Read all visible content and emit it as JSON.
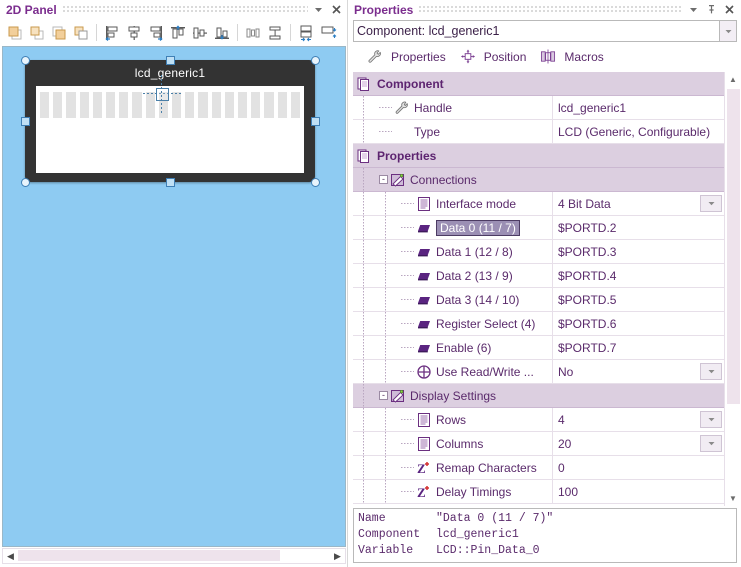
{
  "left": {
    "title": "2D Panel",
    "titlebar_icons": [
      "grip-dots",
      "chevron-down-icon",
      "close-icon"
    ],
    "toolbar": [
      {
        "name": "bring-to-front-button",
        "tip": "Bring to Front"
      },
      {
        "name": "bring-forward-button",
        "tip": "Bring Forward"
      },
      {
        "name": "send-backward-button",
        "tip": "Send Backward"
      },
      {
        "name": "send-to-back-button",
        "tip": "Send to Back"
      },
      {
        "name": "align-left-button",
        "tip": "Align Left"
      },
      {
        "name": "align-center-horizontal-button",
        "tip": "Align Center"
      },
      {
        "name": "align-right-button",
        "tip": "Align Right"
      },
      {
        "name": "align-top-button",
        "tip": "Align Top"
      },
      {
        "name": "align-middle-button",
        "tip": "Align Middle"
      },
      {
        "name": "align-bottom-button",
        "tip": "Align Bottom"
      },
      {
        "name": "distribute-horizontal-button",
        "tip": "Distribute Horizontally"
      },
      {
        "name": "distribute-vertical-button",
        "tip": "Distribute Vertically"
      },
      {
        "name": "make-same-width-button",
        "tip": "Same Width"
      },
      {
        "name": "make-same-height-button",
        "tip": "Same Height"
      }
    ],
    "canvas": {
      "background_color": "#8ecbf2",
      "component_label": "lcd_generic1",
      "component_body_color": "#333333",
      "screen_color": "#ffffff",
      "cell_color": "#e2e2e2",
      "cell_count": 20
    },
    "hscroll": {
      "left_arrow": "◀",
      "right_arrow": "▶"
    }
  },
  "right": {
    "title": "Properties",
    "titlebar_icons": [
      "grip-dots",
      "chevron-down-icon",
      "pin-icon",
      "close-icon"
    ],
    "component_selector": {
      "value": "Component: lcd_generic1",
      "caret": "▾"
    },
    "tabs": [
      {
        "label": "Properties",
        "icon": "wrench-icon",
        "active": true
      },
      {
        "label": "Position",
        "icon": "move-arrows-icon",
        "active": false
      },
      {
        "label": "Macros",
        "icon": "macros-icon",
        "active": false
      }
    ],
    "rows": [
      {
        "kind": "group",
        "indent": 0,
        "icon": "pages-icon",
        "label": "Component",
        "value": "",
        "caret": false
      },
      {
        "kind": "leaf",
        "indent": 1,
        "icon": "wrench-icon",
        "label": "Handle",
        "value": "lcd_generic1",
        "caret": false
      },
      {
        "kind": "leaf",
        "indent": 1,
        "icon": "none",
        "label": "Type",
        "value": "LCD (Generic, Configurable)",
        "caret": false
      },
      {
        "kind": "group",
        "indent": 0,
        "icon": "pages-icon",
        "label": "Properties",
        "value": "",
        "caret": false
      },
      {
        "kind": "sub",
        "indent": 1,
        "icon": "folder-edit-icon",
        "label": "Connections",
        "value": "",
        "caret": false,
        "expander": "-"
      },
      {
        "kind": "leaf",
        "indent": 2,
        "icon": "list-icon",
        "label": "Interface mode",
        "value": "4 Bit Data",
        "caret": true
      },
      {
        "kind": "leaf",
        "indent": 2,
        "icon": "pin-block-icon",
        "label": "Data 0 (11 / 7)",
        "value": "$PORTD.2",
        "caret": false,
        "selected": true
      },
      {
        "kind": "leaf",
        "indent": 2,
        "icon": "pin-block-icon",
        "label": "Data 1 (12 / 8)",
        "value": "$PORTD.3",
        "caret": false
      },
      {
        "kind": "leaf",
        "indent": 2,
        "icon": "pin-block-icon",
        "label": "Data 2 (13 / 9)",
        "value": "$PORTD.4",
        "caret": false
      },
      {
        "kind": "leaf",
        "indent": 2,
        "icon": "pin-block-icon",
        "label": "Data 3 (14 / 10)",
        "value": "$PORTD.5",
        "caret": false
      },
      {
        "kind": "leaf",
        "indent": 2,
        "icon": "pin-block-icon",
        "label": "Register Select (4)",
        "value": "$PORTD.6",
        "caret": false
      },
      {
        "kind": "leaf",
        "indent": 2,
        "icon": "pin-block-icon",
        "label": "Enable (6)",
        "value": "$PORTD.7",
        "caret": false
      },
      {
        "kind": "leaf",
        "indent": 2,
        "icon": "circle-cross-icon",
        "label": "Use Read/Write ...",
        "value": "No",
        "caret": true
      },
      {
        "kind": "sub",
        "indent": 1,
        "icon": "folder-edit-icon",
        "label": "Display Settings",
        "value": "",
        "caret": false,
        "expander": "-"
      },
      {
        "kind": "leaf",
        "indent": 2,
        "icon": "list-icon",
        "label": "Rows",
        "value": "4",
        "caret": true
      },
      {
        "kind": "leaf",
        "indent": 2,
        "icon": "list-icon",
        "label": "Columns",
        "value": "20",
        "caret": true
      },
      {
        "kind": "leaf",
        "indent": 2,
        "icon": "z-plus-icon",
        "label": "Remap Characters",
        "value": "0",
        "caret": false
      },
      {
        "kind": "leaf",
        "indent": 2,
        "icon": "z-plus-icon",
        "label": "Delay Timings",
        "value": "100",
        "caret": false
      }
    ],
    "vscroll": {
      "up_arrow": "▲",
      "down_arrow": "▼"
    },
    "info": {
      "lines": [
        {
          "key": "Name",
          "value": "\"Data 0 (11 / 7)\""
        },
        {
          "key": "Component",
          "value": "lcd_generic1"
        },
        {
          "key": "Variable",
          "value": "LCD::Pin_Data_0"
        }
      ]
    }
  },
  "colors": {
    "accent_purple": "#7b2d8e",
    "text_purple": "#5a2a6b",
    "group_row": "#dccfe0",
    "canvas_blue": "#8ecbf2",
    "selection_blue": "#3f7fb5"
  }
}
